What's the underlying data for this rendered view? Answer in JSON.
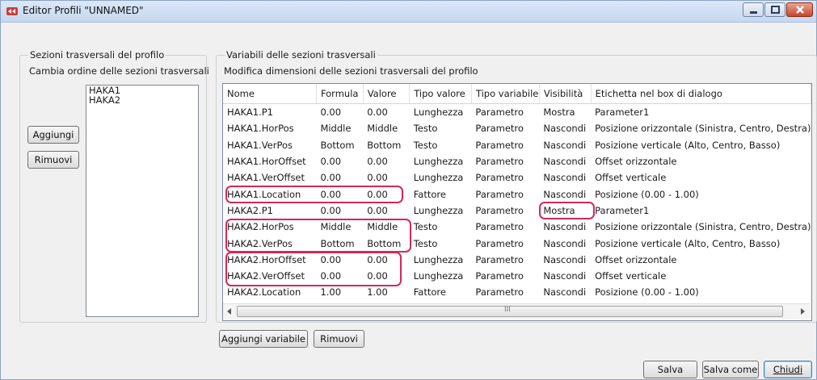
{
  "window": {
    "title": "Editor Profili \"UNNAMED\""
  },
  "left_group": {
    "title": "Sezioni trasversali del profilo",
    "subtitle": "Cambia ordine delle sezioni trasversali",
    "items": [
      "HAKA1",
      "HAKA2"
    ],
    "add_label": "Aggiungi",
    "remove_label": "Rimuovi"
  },
  "right_group": {
    "title": "Variabili delle sezioni trasversali",
    "subtitle": "Modifica dimensioni delle sezioni trasversali del profilo",
    "columns": [
      "Nome",
      "Formula",
      "Valore",
      "Tipo valore",
      "Tipo variabile",
      "Visibilità",
      "Etichetta nel box di dialogo"
    ],
    "rows": [
      [
        "HAKA1.P1",
        "0.00",
        "0.00",
        "Lunghezza",
        "Parametro",
        "Mostra",
        "Parameter1"
      ],
      [
        "HAKA1.HorPos",
        "Middle",
        "Middle",
        "Testo",
        "Parametro",
        "Nascondi",
        "Posizione orizzontale (Sinistra, Centro, Destra)"
      ],
      [
        "HAKA1.VerPos",
        "Bottom",
        "Bottom",
        "Testo",
        "Parametro",
        "Nascondi",
        "Posizione verticale (Alto, Centro, Basso)"
      ],
      [
        "HAKA1.HorOffset",
        "0.00",
        "0.00",
        "Lunghezza",
        "Parametro",
        "Nascondi",
        "Offset orizzontale"
      ],
      [
        "HAKA1.VerOffset",
        "0.00",
        "0.00",
        "Lunghezza",
        "Parametro",
        "Nascondi",
        "Offset verticale"
      ],
      [
        "HAKA1.Location",
        "0.00",
        "0.00",
        "Fattore",
        "Parametro",
        "Nascondi",
        "Posizione (0.00 - 1.00)"
      ],
      [
        "HAKA2.P1",
        "0.00",
        "0.00",
        "Lunghezza",
        "Parametro",
        "Mostra",
        "Parameter1"
      ],
      [
        "HAKA2.HorPos",
        "Middle",
        "Middle",
        "Testo",
        "Parametro",
        "Nascondi",
        "Posizione orizzontale (Sinistra, Centro, Destra)"
      ],
      [
        "HAKA2.VerPos",
        "Bottom",
        "Bottom",
        "Testo",
        "Parametro",
        "Nascondi",
        "Posizione verticale (Alto, Centro, Basso)"
      ],
      [
        "HAKA2.HorOffset",
        "0.00",
        "0.00",
        "Lunghezza",
        "Parametro",
        "Nascondi",
        "Offset orizzontale"
      ],
      [
        "HAKA2.VerOffset",
        "0.00",
        "0.00",
        "Lunghezza",
        "Parametro",
        "Nascondi",
        "Offset verticale"
      ],
      [
        "HAKA2.Location",
        "1.00",
        "1.00",
        "Fattore",
        "Parametro",
        "Nascondi",
        "Posizione (0.00 - 1.00)"
      ]
    ],
    "scroll_grip": "III",
    "add_variable_label": "Aggiungi variabile",
    "remove_variable_label": "Rimuovi"
  },
  "footer": {
    "save_label": "Salva",
    "save_as_label": "Salva come",
    "close_label": "Chiudi"
  },
  "colors": {
    "highlight": "#d2285a",
    "title_bar": "#c5d8ef",
    "close_button": "#c8452b"
  }
}
